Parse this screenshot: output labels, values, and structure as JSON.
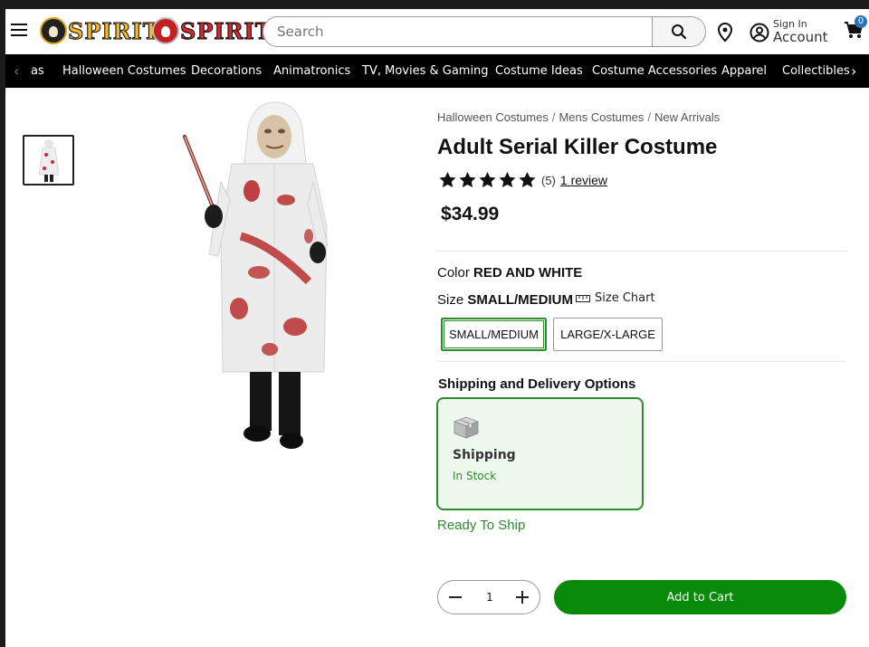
{
  "header": {
    "search_placeholder": "Search",
    "sign_in_label": "Sign In",
    "account_label": "Account",
    "cart_count": "0",
    "logo1_text": "SPIRIT",
    "logo2_text": "SPIRIT",
    "icons": [
      "menu-icon",
      "search-icon",
      "location-pin-icon",
      "account-icon",
      "cart-icon"
    ]
  },
  "nav": {
    "items": [
      "as",
      "Halloween Costumes",
      "Decorations",
      "Animatronics",
      "TV, Movies & Gaming",
      "Costume Ideas",
      "Costume Accessories",
      "Apparel",
      "Collectibles"
    ],
    "left_arrow": "‹",
    "right_arrow": "›"
  },
  "breadcrumb": [
    "Halloween Costumes",
    "Mens Costumes",
    "New Arrivals"
  ],
  "breadcrumb_separator": "/",
  "product": {
    "title": "Adult Serial Killer Costume",
    "rating": 5,
    "rating_count": "(5)",
    "review_link": "1 review",
    "price": "$34.99",
    "color_label": "Color",
    "color_value": "RED AND WHITE",
    "size_label": "Size",
    "size_value": "SMALL/MEDIUM",
    "size_chart_label": "Size Chart",
    "sizes": [
      "SMALL/MEDIUM",
      "LARGE/X-LARGE"
    ],
    "selected_size": "SMALL/MEDIUM"
  },
  "shipping": {
    "heading": "Shipping and Delivery Options",
    "option_title": "Shipping",
    "option_status": "In Stock",
    "ready_text": "Ready To Ship"
  },
  "purchase": {
    "quantity": "1",
    "add_to_cart_label": "Add to Cart"
  },
  "colors": {
    "accent_green": "#0a8a0a",
    "nav_background": "#000000",
    "selected_border": "#2e8b2e"
  }
}
